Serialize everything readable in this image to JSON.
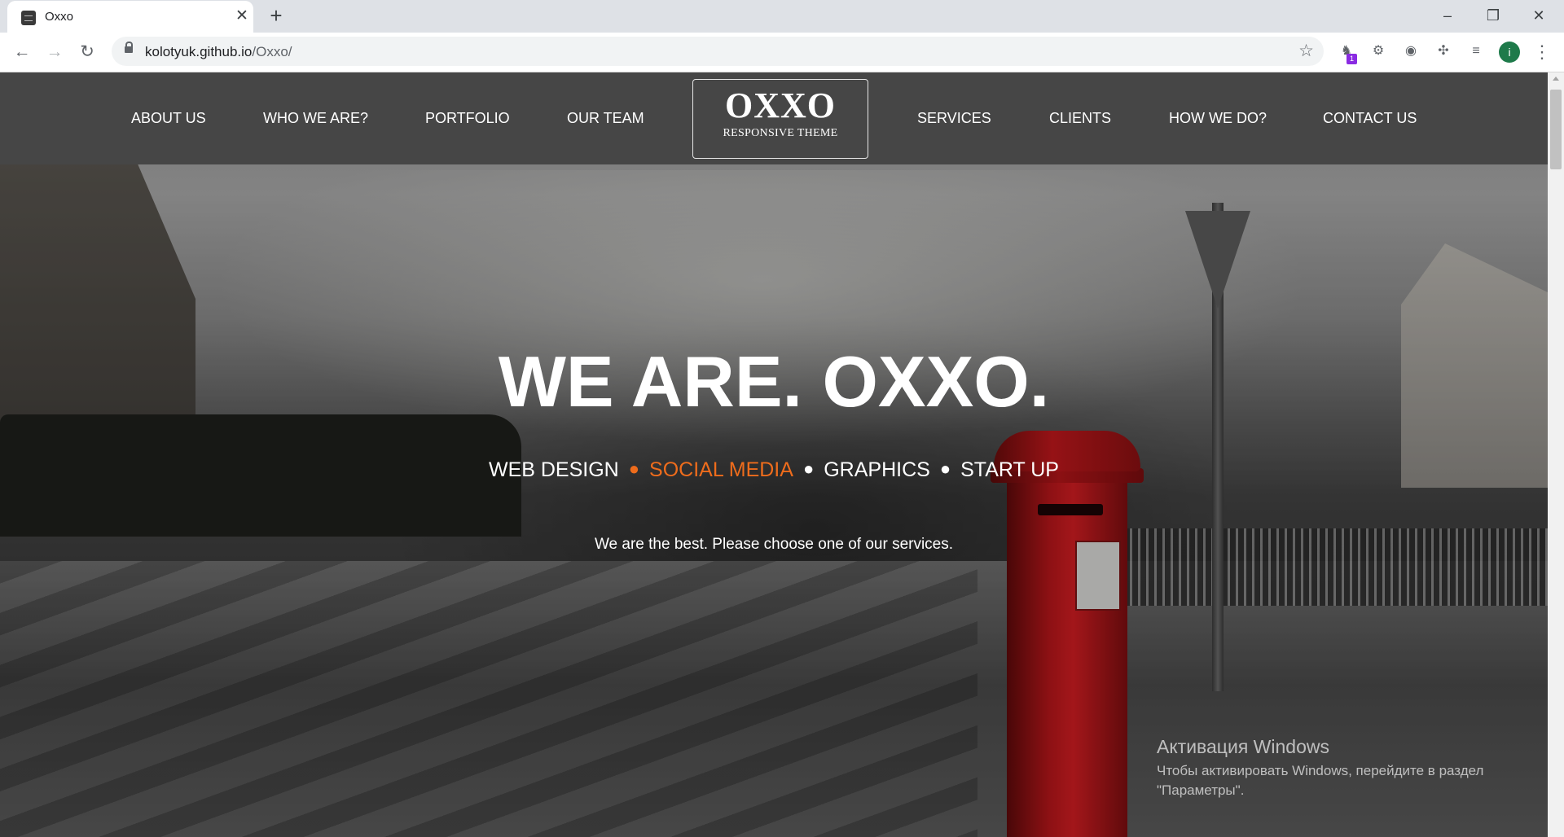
{
  "browser": {
    "tab_title": "Oxxo",
    "tab_close_glyph": "✕",
    "new_tab_glyph": "+",
    "url_host": "kolotyuk.github.io",
    "url_path": "/Oxxo/",
    "icons": [
      "back-icon",
      "forward-icon",
      "reload-icon",
      "lock-icon",
      "star-icon",
      "extension-icon",
      "puzzle-icon",
      "media-icon",
      "menu-icon"
    ],
    "extension_badge": "1",
    "profile_initial": "i",
    "window_controls": [
      "–",
      "❐",
      "✕"
    ]
  },
  "site": {
    "nav_left": [
      "ABOUT US",
      "WHO WE ARE?",
      "PORTFOLIO",
      "OUR TEAM"
    ],
    "nav_right": [
      "SERVICES",
      "CLIENTS",
      "HOW WE DO?",
      "CONTACT US"
    ],
    "logo_title": "OXXO",
    "logo_subtitle": "RESPONSIVE THEME"
  },
  "hero": {
    "headline": "WE ARE. OXXO.",
    "tagline": [
      "WEB DESIGN",
      "SOCIAL MEDIA",
      "GRAPHICS",
      "START UP"
    ],
    "tagline_active_index": 1,
    "lead": "We are the best. Please choose one of our services.",
    "accent_color": "#ee6c1c"
  },
  "watermark": {
    "title": "Активация Windows",
    "line1": "Чтобы активировать Windows, перейдите в раздел",
    "line2": "\"Параметры\"."
  }
}
